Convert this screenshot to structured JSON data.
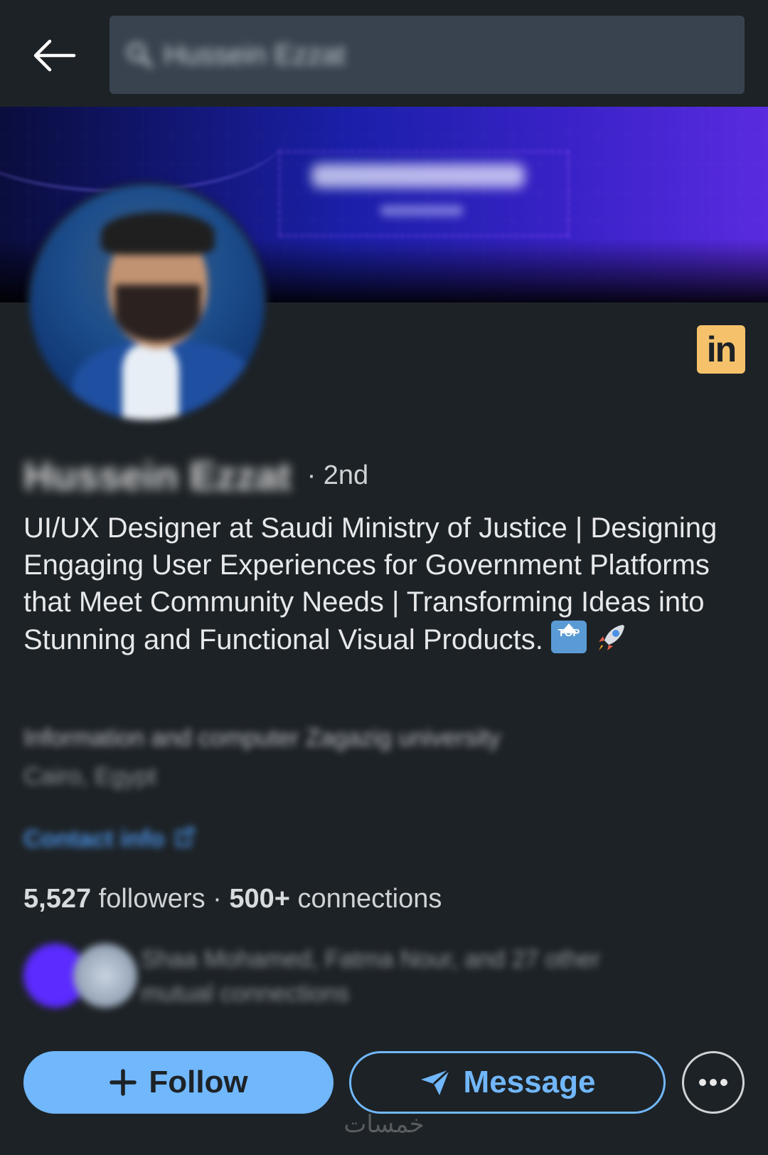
{
  "search": {
    "query": "Hussein Ezzat"
  },
  "banner": {
    "title": "Hussein Ezzat",
    "subtitle": "UI/UX Designer"
  },
  "profile": {
    "name": "Hussein Ezzat",
    "degree": "· 2nd",
    "headline": "UI/UX Designer at Saudi Ministry of Justice | Designing Engaging User Experiences for Government Platforms that Meet Community Needs | Transforming Ideas into Stunning and Functional Visual Products.",
    "top_emoji_text": "TOP",
    "education": "Information and computer Zagazig university",
    "location": "Cairo, Egypt",
    "contact_info": "Contact info"
  },
  "stats": {
    "followers_count": "5,527",
    "followers_label": "followers",
    "separator": "·",
    "connections_count": "500+",
    "connections_label": "connections"
  },
  "mutual": {
    "text": "Shaa Mohamed, Fatma Nour, and 27 other mutual connections"
  },
  "actions": {
    "follow_label": "Follow",
    "message_label": "Message"
  },
  "badge": {
    "label": "in"
  },
  "watermark": "خمسات",
  "colors": {
    "accent": "#71b7fb",
    "background": "#1d2226",
    "badge": "#f5c26b"
  }
}
